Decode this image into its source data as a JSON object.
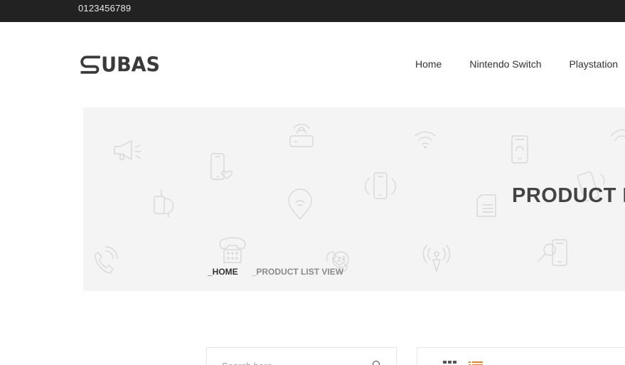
{
  "topbar": {
    "phone": "0123456789"
  },
  "logo": {
    "text": "UBAS"
  },
  "nav": {
    "items": [
      "Home",
      "Nintendo Switch",
      "Playstation"
    ]
  },
  "banner": {
    "title": "PRODUCT LIST VIEW",
    "breadcrumb": {
      "home": "_HOME",
      "current": "_PRODUCT LIST VIEW"
    }
  },
  "search": {
    "placeholder": "Search here"
  },
  "colors": {
    "topbar": "#222222",
    "banner_bg": "#f4f4f4",
    "accent": "#f47c20",
    "dark": "#3a3a3a"
  }
}
